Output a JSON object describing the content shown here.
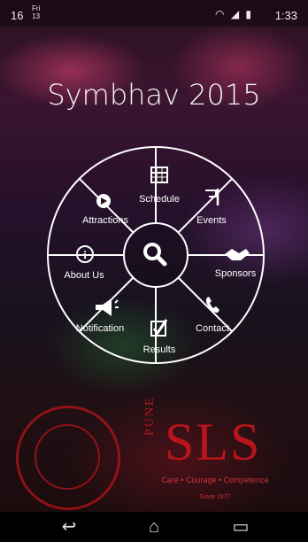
{
  "status_bar": {
    "time_left": "16",
    "day": "Fri",
    "date": "13",
    "time": "1:33"
  },
  "app": {
    "title": "Symbhav 2015"
  },
  "menu": {
    "center_icon": "search-icon",
    "items": [
      {
        "label": "Schedule",
        "icon": "calendar-icon"
      },
      {
        "label": "Events",
        "icon": "flag-icon"
      },
      {
        "label": "Sponsors",
        "icon": "handshake-icon"
      },
      {
        "label": "Contact",
        "icon": "phone-icon"
      },
      {
        "label": "Results",
        "icon": "checkbox-icon"
      },
      {
        "label": "Notification",
        "icon": "megaphone-icon"
      },
      {
        "label": "About Us",
        "icon": "info-icon"
      },
      {
        "label": "Attractions",
        "icon": "play-icon"
      }
    ]
  },
  "branding": {
    "logo_text": "SLS",
    "city": "PUNE",
    "tagline": "Care • Courage • Competence",
    "since": "Since 1977",
    "brand_color": "#b7151b"
  },
  "nav_bar": {
    "back_icon": "back-icon",
    "home_icon": "home-icon",
    "recents_icon": "recents-icon"
  }
}
